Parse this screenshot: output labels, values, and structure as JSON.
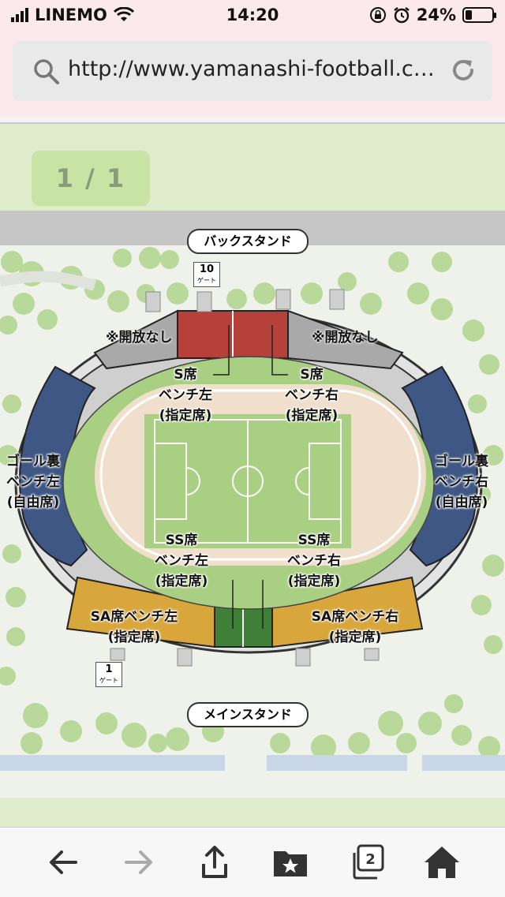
{
  "status": {
    "carrier": "LINEMO",
    "time": "14:20",
    "battery_percent": "24%",
    "battery_level": 0.24
  },
  "browser": {
    "url": "http://www.yamanashi-football.c…",
    "tabs_count": "2"
  },
  "map": {
    "page_indicator": "1 / 1",
    "back_stand": "バックスタンド",
    "main_stand": "メインスタンド",
    "gate_top_number": "10",
    "gate_top_label": "ゲート",
    "gate_bottom_number": "1",
    "gate_bottom_label": "ゲート",
    "closed_left": "※開放なし",
    "closed_right": "※開放なし",
    "s_left": [
      "S席",
      "ベンチ左",
      "(指定席)"
    ],
    "s_right": [
      "S席",
      "ベンチ右",
      "(指定席)"
    ],
    "ss_left": [
      "SS席",
      "ベンチ左",
      "(指定席)"
    ],
    "ss_right": [
      "SS席",
      "ベンチ右",
      "(指定席)"
    ],
    "goal_left": [
      "ゴール裏",
      "ベンチ左",
      "(自由席)"
    ],
    "goal_right": [
      "ゴール裏",
      "ベンチ右",
      "(自由席)"
    ],
    "sa_left": [
      "SA席ベンチ左",
      "(指定席)"
    ],
    "sa_right": [
      "SA席ベンチ右",
      "(指定席)"
    ],
    "colors": {
      "s_seat": "#b5413a",
      "ss_seat": "#3f7f37",
      "sa_seat": "#d9a63b",
      "goal_seat": "#3e5784",
      "closed": "#a9a9a9",
      "track": "#f0dfcc",
      "pitch": "#a9cf82"
    }
  },
  "icons": [
    "search-icon",
    "reload-icon",
    "back-arrow-icon",
    "forward-arrow-icon",
    "share-icon",
    "bookmark-star-icon",
    "tabs-icon",
    "home-icon",
    "wifi-icon",
    "lock-rotation-icon",
    "alarm-icon",
    "battery-icon",
    "signal-icon"
  ]
}
